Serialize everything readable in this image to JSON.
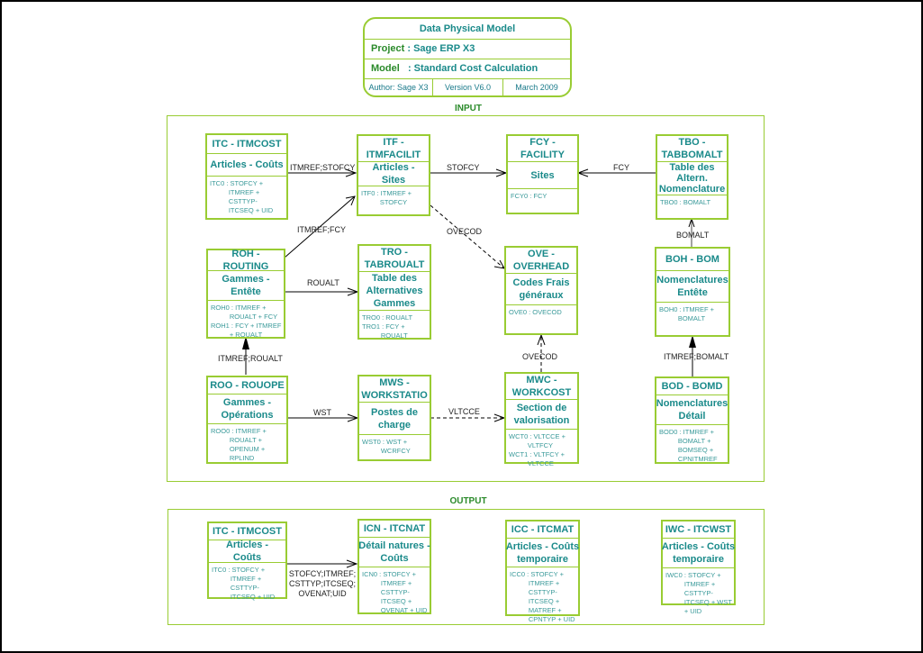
{
  "title_block": {
    "title": "Data Physical Model",
    "project_key": "Project",
    "project_value": ": Sage ERP X3",
    "model_key": "Model",
    "model_value": ": Standard Cost Calculation",
    "author": "Author: Sage X3",
    "version": "Version V6.0",
    "date": "March 2009"
  },
  "sections": {
    "input_label": "INPUT",
    "output_label": "OUTPUT"
  },
  "entities": {
    "itc_in": {
      "header": "ITC - ITMCOST",
      "body": "Articles - Coûts",
      "index": "ITC0 : STOFCY +\n          ITMREF +\n          CSTTYP-\n          ITCSEQ + UID"
    },
    "itf": {
      "header": "ITF -\nITMFACILIT",
      "body": "Articles - Sites",
      "index": "ITF0 : ITMREF +\n          STOFCY"
    },
    "fcy": {
      "header": "FCY -\nFACILITY",
      "body": "Sites",
      "index": "FCY0 : FCY"
    },
    "tbo": {
      "header": "TBO -\nTABBOMALT",
      "body": "Table des\nAltern.\nNomenclature",
      "index": "TBO0 : BOMALT"
    },
    "roh": {
      "header": "ROH - ROUTING",
      "body": "Gammes -\nEntête",
      "index": "ROH0 : ITMREF +\n          ROUALT + FCY\nROH1 : FCY + ITMREF\n          + ROUALT"
    },
    "tro": {
      "header": "TRO -\nTABROUALT",
      "body": "Table des\nAlternatives\nGammes",
      "index": "TRO0 : ROUALT\nTRO1 : FCY +\n          ROUALT"
    },
    "ove": {
      "header": "OVE -\nOVERHEAD",
      "body": "Codes Frais\ngénéraux",
      "index": "OVE0 : OVECOD"
    },
    "boh": {
      "header": "BOH - BOM",
      "body": "Nomenclatures\nEntête",
      "index": "BOH0 : ITMREF +\n          BOMALT"
    },
    "roo": {
      "header": "ROO - ROUOPE",
      "body": "Gammes -\nOpérations",
      "index": "ROO0 : ITMREF +\n          ROUALT +\n          OPENUM +\n          RPLIND"
    },
    "mws": {
      "header": "MWS -\nWORKSTATIO",
      "body": "Postes de\ncharge",
      "index": "WST0 : WST +\n          WCRFCY"
    },
    "mwc": {
      "header": "MWC -\nWORKCOST",
      "body": "Section de\nvalorisation",
      "index": "WCT0 : VLTCCE +\n          VLTFCY\nWCT1 : VLTFCY +\n          VLTCCE"
    },
    "bod": {
      "header": "BOD - BOMD",
      "body": "Nomenclatures\nDétail",
      "index": "BOD0 : ITMREF +\n          BOMALT +\n          BOMSEQ +\n          CPNITMREF"
    },
    "itc_out": {
      "header": "ITC - ITMCOST",
      "body": "Articles - Coûts",
      "index": "ITC0 : STOFCY +\n          ITMREF +\n          CSTTYP-\n          ITCSEQ + UID"
    },
    "icn": {
      "header": "ICN - ITCNAT",
      "body": "Détail natures -\nCoûts",
      "index": "ICN0 : STOFCY +\n          ITMREF +\n          CSTTYP-\n          ITCSEQ +\n          OVENAT + UID"
    },
    "icc": {
      "header": "ICC - ITCMAT",
      "body": "Articles - Coûts\ntemporaire",
      "index": "ICC0 : STOFCY +\n          ITMREF +\n          CSTTYP-\n          ITCSEQ +\n          MATREF +\n          CPNTYP + UID"
    },
    "iwc": {
      "header": "IWC - ITCWST",
      "body": "Articles - Coûts\ntemporaire",
      "index": "IWC0 : STOFCY +\n          ITMREF +\n          CSTTYP-\n          ITCSEQ + WST\n          + UID"
    }
  },
  "relations": {
    "itc_itf": "ITMREF;STOFCY",
    "roh_itf": "ITMREF;FCY",
    "itf_fcy": "STOFCY",
    "tbo_fcy": "FCY",
    "itf_ove": "OVECOD",
    "boh_tbo": "BOMALT",
    "roh_tro": "ROUALT",
    "roo_roh": "ITMREF;ROUALT",
    "roo_mws": "WST",
    "mws_mwc": "VLTCCE",
    "mwc_ove": "OVECOD",
    "bod_boh": "ITMREF;BOMALT",
    "itc_icn": "STOFCY;ITMREF;\nCSTTYP;ITCSEQ;\nOVENAT;UID"
  }
}
